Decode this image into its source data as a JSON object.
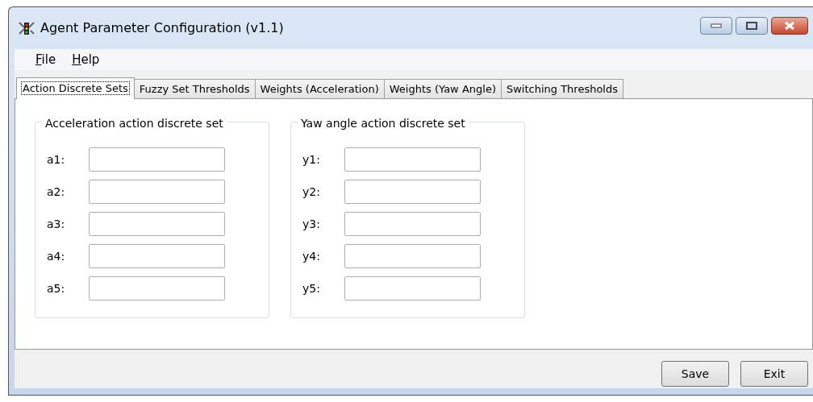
{
  "window": {
    "title": "Agent Parameter Configuration (v1.1)"
  },
  "menu": [
    "File",
    "Help"
  ],
  "tabs": [
    {
      "label": "Action Discrete Sets",
      "selected": true
    },
    {
      "label": "Fuzzy Set Thresholds",
      "selected": false
    },
    {
      "label": "Weights (Acceleration)",
      "selected": false
    },
    {
      "label": "Weights (Yaw Angle)",
      "selected": false
    },
    {
      "label": "Switching Thresholds",
      "selected": false
    }
  ],
  "groups": [
    {
      "title": "Acceleration action discrete set",
      "fields": [
        {
          "label": "a1:"
        },
        {
          "label": "a2:"
        },
        {
          "label": "a3:"
        },
        {
          "label": "a4:"
        },
        {
          "label": "a5:"
        }
      ]
    },
    {
      "title": "Yaw angle action discrete set",
      "fields": [
        {
          "label": "y1:"
        },
        {
          "label": "y2:"
        },
        {
          "label": "y3:"
        },
        {
          "label": "y4:"
        },
        {
          "label": "y5:"
        }
      ]
    }
  ],
  "buttons": [
    "Save",
    "Exit"
  ]
}
